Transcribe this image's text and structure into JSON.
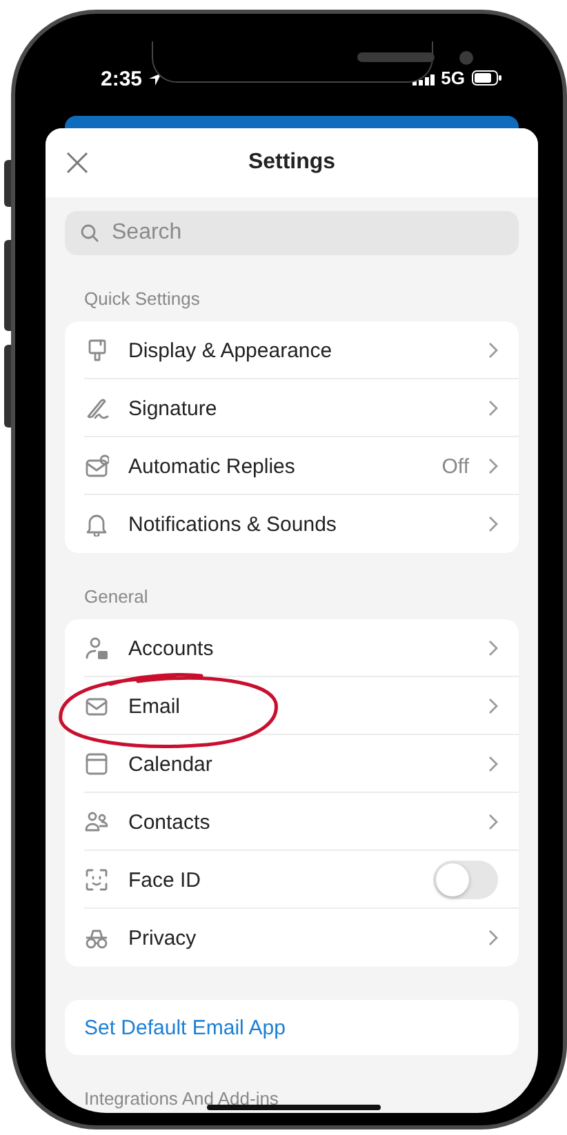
{
  "status_bar": {
    "time": "2:35",
    "network": "5G"
  },
  "header": {
    "title": "Settings"
  },
  "search": {
    "placeholder": "Search"
  },
  "sections": [
    {
      "title": "Quick Settings",
      "items": [
        {
          "kind": "link",
          "label": "Display & Appearance"
        },
        {
          "kind": "link",
          "label": "Signature"
        },
        {
          "kind": "value",
          "label": "Automatic Replies",
          "value": "Off"
        },
        {
          "kind": "link",
          "label": "Notifications & Sounds"
        }
      ]
    },
    {
      "title": "General",
      "items": [
        {
          "kind": "link",
          "label": "Accounts"
        },
        {
          "kind": "link",
          "label": "Email"
        },
        {
          "kind": "link",
          "label": "Calendar"
        },
        {
          "kind": "link",
          "label": "Contacts"
        },
        {
          "kind": "toggle",
          "label": "Face ID",
          "on": false
        },
        {
          "kind": "link",
          "label": "Privacy"
        }
      ]
    },
    {
      "actions": [
        {
          "label": "Set Default Email App"
        }
      ]
    },
    {
      "title": "Integrations And Add-ins"
    }
  ]
}
